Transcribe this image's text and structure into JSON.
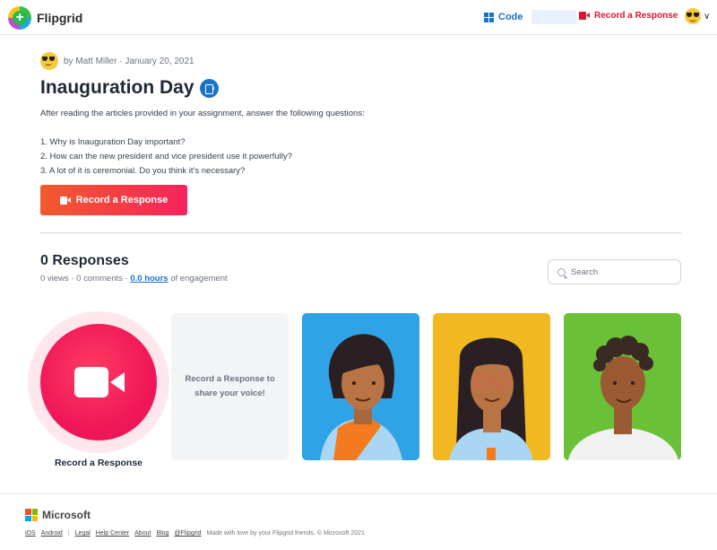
{
  "header": {
    "app_name": "Flipgrid",
    "logo_glyph": "+",
    "code_label": "Code",
    "code_value": "",
    "record_label": "Record a Response",
    "accent_color": "#e0142d",
    "link_color": "#1a73c8",
    "user_menu_icon": "chevron-down-icon"
  },
  "topic": {
    "author": "by Matt Miller",
    "date": "January 20, 2021",
    "author_line": "by Matt Miller · January 20, 2021",
    "title": "Inauguration Day",
    "intro": "After reading the articles provided in your assignment, answer the following questions:",
    "questions": [
      "1. Why is Inauguration Day important?",
      "2. How can the new president and vice president use it powerfully?",
      "3. A lot of it is ceremonial. Do you think it's necessary?"
    ],
    "record_button": "Record a Response"
  },
  "responses": {
    "title": "0 Responses",
    "views": "0 views",
    "comments": "0 comments",
    "hours": "0.0 hours",
    "engagement_suffix": "of engagement",
    "search_placeholder": "Search",
    "record_label": "Record a Response",
    "placeholder_text": "Record a Response to share your voice!",
    "card_colors": [
      "#2fa3e6",
      "#f2b81f",
      "#6ac138"
    ]
  },
  "footer": {
    "brand": "Microsoft",
    "links": [
      "iOS",
      "Android",
      "Legal",
      "Help Center",
      "About",
      "Blog",
      "@Flipgrid"
    ],
    "note": "Made with love by your Flipgrid friends. © Microsoft 2021"
  }
}
